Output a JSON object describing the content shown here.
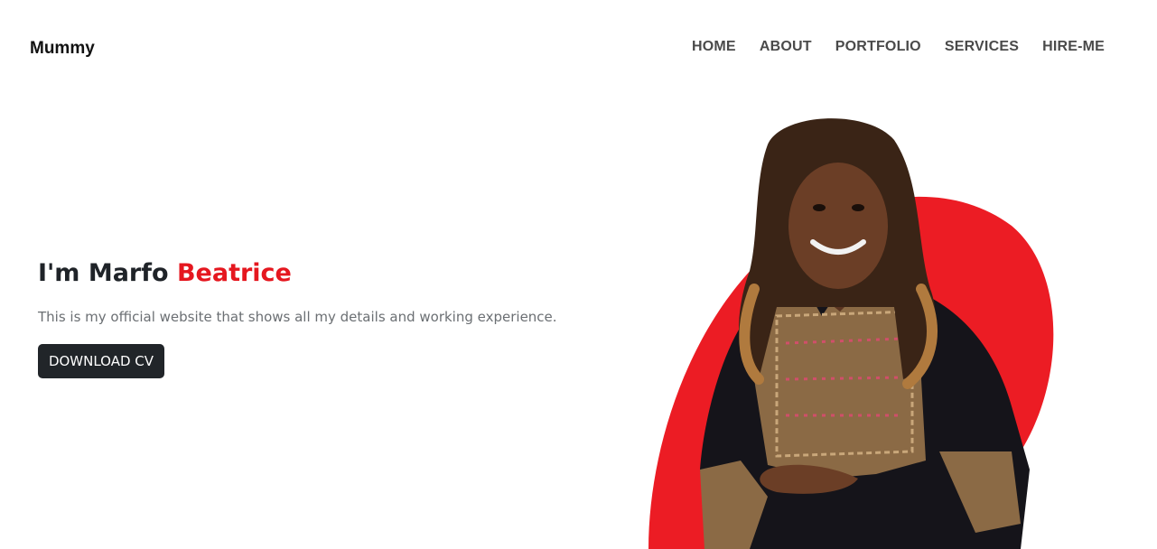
{
  "header": {
    "brand": "Mummy",
    "nav": [
      "HOME",
      "ABOUT",
      "PORTFOLIO",
      "SERVICES",
      "HIRE-ME"
    ]
  },
  "hero": {
    "greeting": "I'm Marfo ",
    "name_highlight": "Beatrice",
    "subtitle": "This is my official website that shows all my details and working experience.",
    "cta_label": "DOWNLOAD CV"
  },
  "colors": {
    "accent": "#e5171f",
    "button_bg": "#212529",
    "nav_text": "#4a4a4a"
  }
}
